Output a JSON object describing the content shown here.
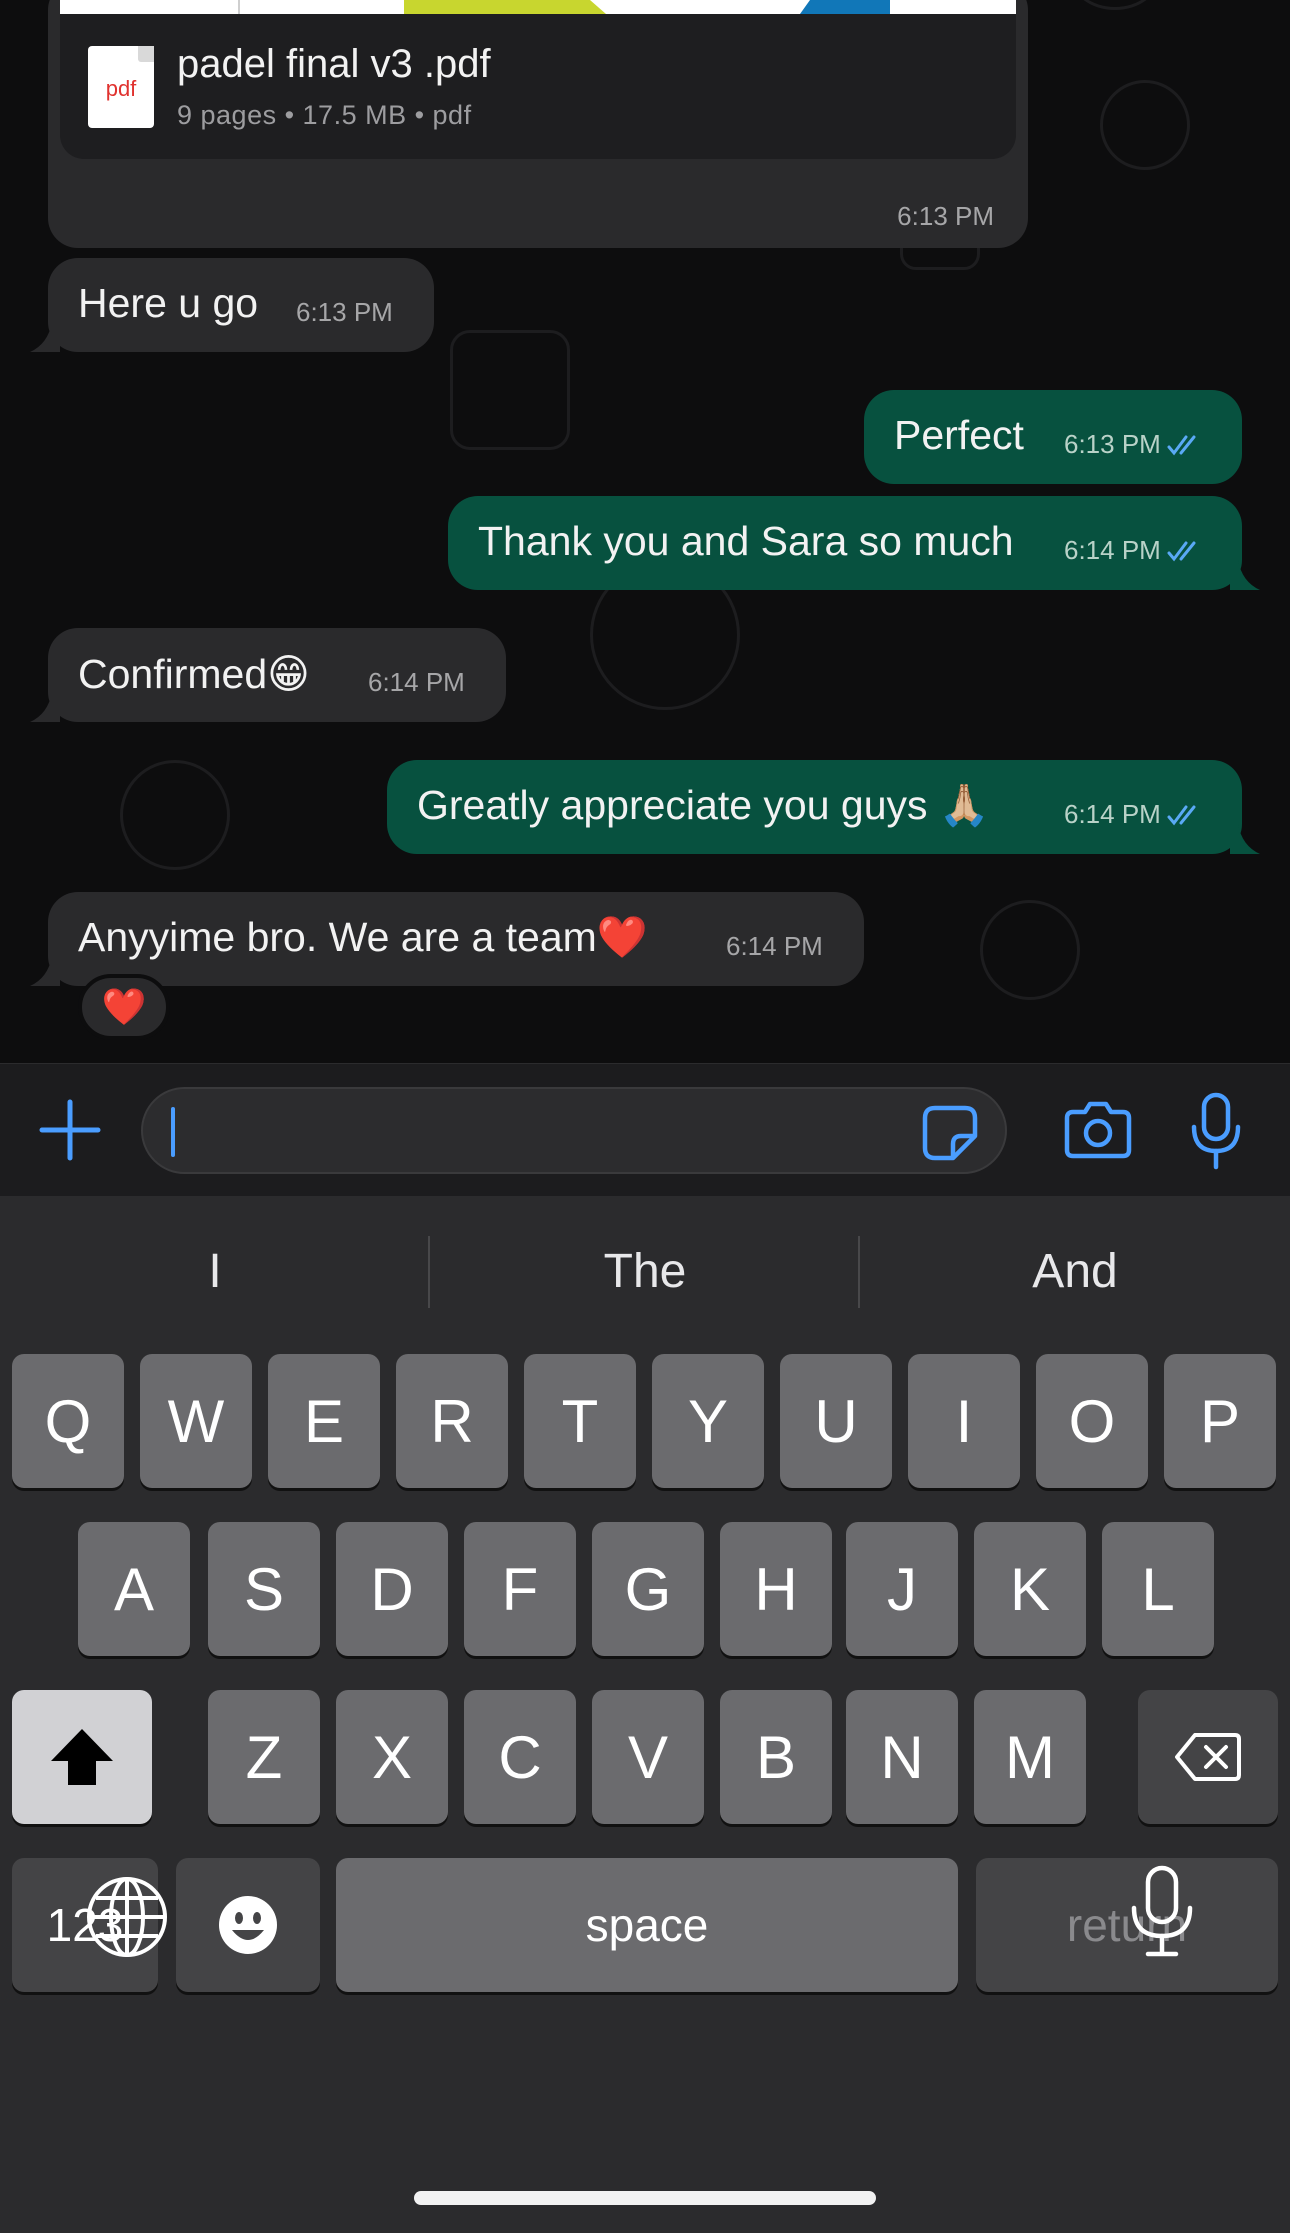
{
  "document_message": {
    "file_icon_label": "pdf",
    "file_name": "padel final v3 .pdf",
    "meta": "9 pages • 17.5 MB • pdf",
    "time": "6:13 PM"
  },
  "messages": [
    {
      "direction": "in",
      "text": "Here u go",
      "time": "6:13 PM"
    },
    {
      "direction": "out",
      "text": "Perfect",
      "time": "6:13 PM",
      "status": "read"
    },
    {
      "direction": "out",
      "text": "Thank you and Sara so much",
      "time": "6:14 PM",
      "status": "read"
    },
    {
      "direction": "in",
      "text": "Confirmed😁",
      "time": "6:14 PM"
    },
    {
      "direction": "out",
      "text": "Greatly appreciate you guys 🙏🏼",
      "time": "6:14 PM",
      "status": "read"
    },
    {
      "direction": "in",
      "text": "Anyyime bro. We are a team❤️",
      "time": "6:14 PM",
      "reaction": "❤️"
    }
  ],
  "composer": {
    "input_value": "",
    "icons": [
      "plus-icon",
      "sticker-icon",
      "camera-icon",
      "microphone-icon"
    ]
  },
  "keyboard": {
    "suggestions": [
      "I",
      "The",
      "And"
    ],
    "row1": [
      "Q",
      "W",
      "E",
      "R",
      "T",
      "Y",
      "U",
      "I",
      "O",
      "P"
    ],
    "row2": [
      "A",
      "S",
      "D",
      "F",
      "G",
      "H",
      "J",
      "K",
      "L"
    ],
    "row3": [
      "Z",
      "X",
      "C",
      "V",
      "B",
      "N",
      "M"
    ],
    "numbers_label": "123",
    "space_label": "space",
    "return_label": "return",
    "icons": [
      "shift-icon",
      "backspace-icon",
      "emoji-icon",
      "globe-icon",
      "dictation-icon"
    ]
  },
  "colors": {
    "outgoing_bubble": "#07513f",
    "incoming_bubble": "#2a2a2c",
    "accent": "#4a9dff",
    "read_ticks": "#5aa9f5"
  }
}
